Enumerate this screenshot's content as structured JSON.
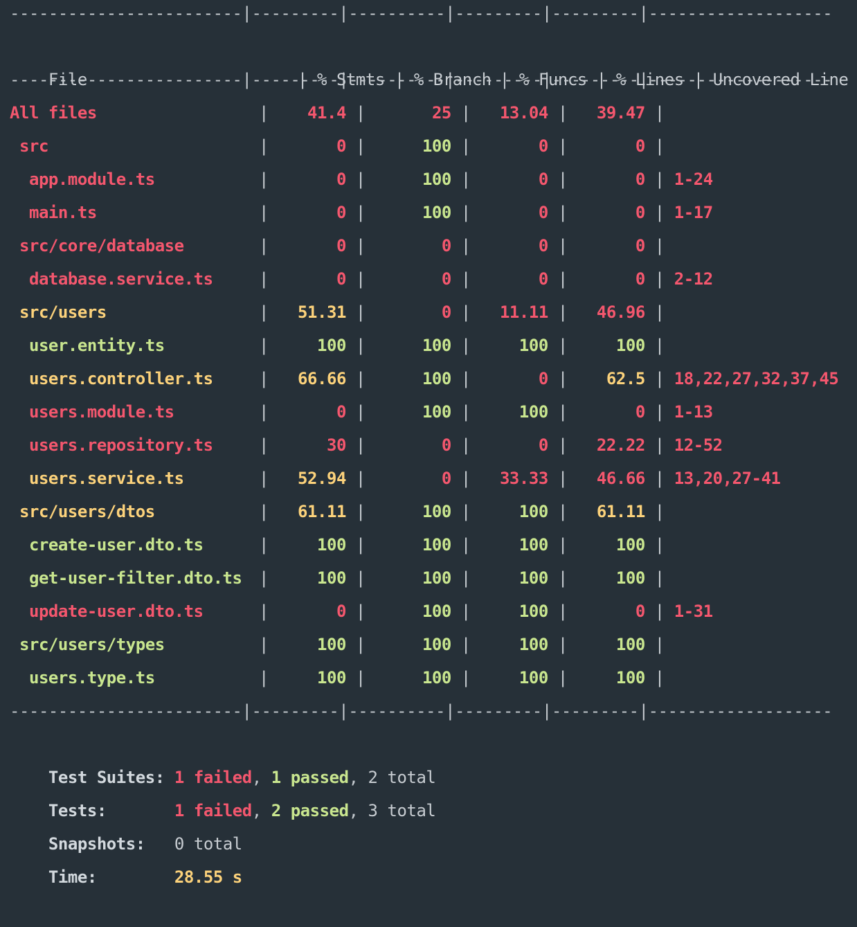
{
  "colors": {
    "background": "#263038",
    "text": "#c7ccd1",
    "low": "#f4576e",
    "medium": "#fcd27b",
    "high": "#c9e68f"
  },
  "table": {
    "separator": "------------------------|---------|----------|---------|---------|-------------------",
    "headers": {
      "file": "File",
      "stmts": "% Stmts",
      "branch": "% Branch",
      "funcs": "% Funcs",
      "lines": "% Lines",
      "uncovered": "Uncovered Line #s"
    },
    "rows": [
      {
        "file": "All files",
        "indent": 0,
        "color": "red",
        "stmts": "41.4",
        "stmts_color": "red",
        "branch": "25",
        "branch_color": "red",
        "funcs": "13.04",
        "funcs_color": "red",
        "lines": "39.47",
        "lines_color": "red",
        "uncovered": ""
      },
      {
        "file": "src",
        "indent": 1,
        "color": "red",
        "stmts": "0",
        "stmts_color": "red",
        "branch": "100",
        "branch_color": "green",
        "funcs": "0",
        "funcs_color": "red",
        "lines": "0",
        "lines_color": "red",
        "uncovered": ""
      },
      {
        "file": "app.module.ts",
        "indent": 2,
        "color": "red",
        "stmts": "0",
        "stmts_color": "red",
        "branch": "100",
        "branch_color": "green",
        "funcs": "0",
        "funcs_color": "red",
        "lines": "0",
        "lines_color": "red",
        "uncovered": "1-24"
      },
      {
        "file": "main.ts",
        "indent": 2,
        "color": "red",
        "stmts": "0",
        "stmts_color": "red",
        "branch": "100",
        "branch_color": "green",
        "funcs": "0",
        "funcs_color": "red",
        "lines": "0",
        "lines_color": "red",
        "uncovered": "1-17"
      },
      {
        "file": "src/core/database",
        "indent": 1,
        "color": "red",
        "stmts": "0",
        "stmts_color": "red",
        "branch": "0",
        "branch_color": "red",
        "funcs": "0",
        "funcs_color": "red",
        "lines": "0",
        "lines_color": "red",
        "uncovered": ""
      },
      {
        "file": "database.service.ts",
        "indent": 2,
        "color": "red",
        "stmts": "0",
        "stmts_color": "red",
        "branch": "0",
        "branch_color": "red",
        "funcs": "0",
        "funcs_color": "red",
        "lines": "0",
        "lines_color": "red",
        "uncovered": "2-12"
      },
      {
        "file": "src/users",
        "indent": 1,
        "color": "yellow",
        "stmts": "51.31",
        "stmts_color": "yellow",
        "branch": "0",
        "branch_color": "red",
        "funcs": "11.11",
        "funcs_color": "red",
        "lines": "46.96",
        "lines_color": "red",
        "uncovered": ""
      },
      {
        "file": "user.entity.ts",
        "indent": 2,
        "color": "green",
        "stmts": "100",
        "stmts_color": "green",
        "branch": "100",
        "branch_color": "green",
        "funcs": "100",
        "funcs_color": "green",
        "lines": "100",
        "lines_color": "green",
        "uncovered": ""
      },
      {
        "file": "users.controller.ts",
        "indent": 2,
        "color": "yellow",
        "stmts": "66.66",
        "stmts_color": "yellow",
        "branch": "100",
        "branch_color": "green",
        "funcs": "0",
        "funcs_color": "red",
        "lines": "62.5",
        "lines_color": "yellow",
        "uncovered": "18,22,27,32,37,45"
      },
      {
        "file": "users.module.ts",
        "indent": 2,
        "color": "red",
        "stmts": "0",
        "stmts_color": "red",
        "branch": "100",
        "branch_color": "green",
        "funcs": "100",
        "funcs_color": "green",
        "lines": "0",
        "lines_color": "red",
        "uncovered": "1-13"
      },
      {
        "file": "users.repository.ts",
        "indent": 2,
        "color": "red",
        "stmts": "30",
        "stmts_color": "red",
        "branch": "0",
        "branch_color": "red",
        "funcs": "0",
        "funcs_color": "red",
        "lines": "22.22",
        "lines_color": "red",
        "uncovered": "12-52"
      },
      {
        "file": "users.service.ts",
        "indent": 2,
        "color": "yellow",
        "stmts": "52.94",
        "stmts_color": "yellow",
        "branch": "0",
        "branch_color": "red",
        "funcs": "33.33",
        "funcs_color": "red",
        "lines": "46.66",
        "lines_color": "red",
        "uncovered": "13,20,27-41"
      },
      {
        "file": "src/users/dtos",
        "indent": 1,
        "color": "yellow",
        "stmts": "61.11",
        "stmts_color": "yellow",
        "branch": "100",
        "branch_color": "green",
        "funcs": "100",
        "funcs_color": "green",
        "lines": "61.11",
        "lines_color": "yellow",
        "uncovered": ""
      },
      {
        "file": "create-user.dto.ts",
        "indent": 2,
        "color": "green",
        "stmts": "100",
        "stmts_color": "green",
        "branch": "100",
        "branch_color": "green",
        "funcs": "100",
        "funcs_color": "green",
        "lines": "100",
        "lines_color": "green",
        "uncovered": ""
      },
      {
        "file": "get-user-filter.dto.ts",
        "indent": 2,
        "color": "green",
        "stmts": "100",
        "stmts_color": "green",
        "branch": "100",
        "branch_color": "green",
        "funcs": "100",
        "funcs_color": "green",
        "lines": "100",
        "lines_color": "green",
        "uncovered": ""
      },
      {
        "file": "update-user.dto.ts",
        "indent": 2,
        "color": "red",
        "stmts": "0",
        "stmts_color": "red",
        "branch": "100",
        "branch_color": "green",
        "funcs": "100",
        "funcs_color": "green",
        "lines": "0",
        "lines_color": "red",
        "uncovered": "1-31"
      },
      {
        "file": "src/users/types",
        "indent": 1,
        "color": "green",
        "stmts": "100",
        "stmts_color": "green",
        "branch": "100",
        "branch_color": "green",
        "funcs": "100",
        "funcs_color": "green",
        "lines": "100",
        "lines_color": "green",
        "uncovered": ""
      },
      {
        "file": "users.type.ts",
        "indent": 2,
        "color": "green",
        "stmts": "100",
        "stmts_color": "green",
        "branch": "100",
        "branch_color": "green",
        "funcs": "100",
        "funcs_color": "green",
        "lines": "100",
        "lines_color": "green",
        "uncovered": ""
      }
    ]
  },
  "summary": {
    "test_suites": {
      "label": "Test Suites:",
      "failed": "1 failed",
      "passed": "1 passed",
      "total": "2 total"
    },
    "tests": {
      "label": "Tests:",
      "failed": "1 failed",
      "passed": "2 passed",
      "total": "3 total"
    },
    "snapshots": {
      "label": "Snapshots:",
      "total": "0 total"
    },
    "time": {
      "label": "Time:",
      "value": "28.55 s"
    }
  },
  "punctuation": {
    "comma": ", "
  }
}
